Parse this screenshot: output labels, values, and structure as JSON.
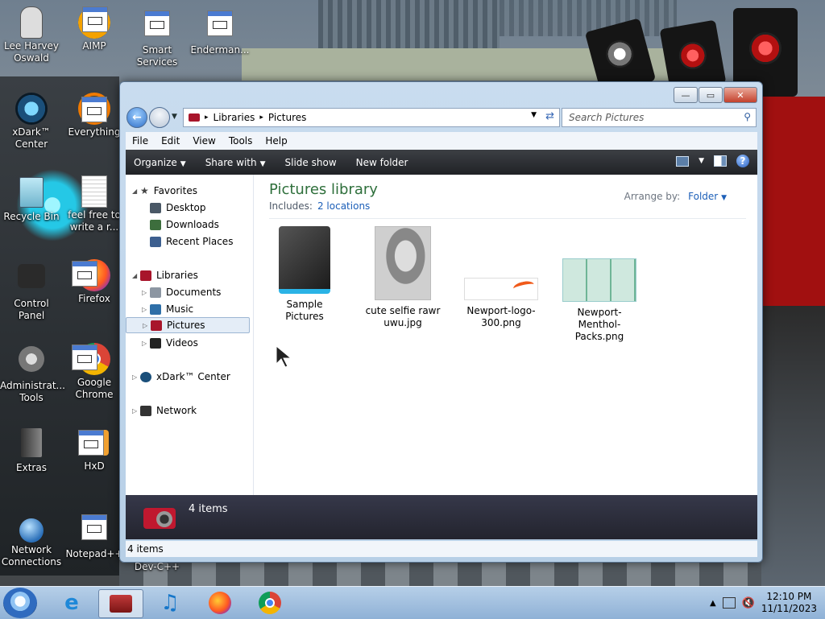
{
  "desktop": {
    "icons": [
      {
        "label": "Lee Harvey Oswald",
        "icon": "person-avatar-icon"
      },
      {
        "label": "AIMP",
        "icon": "aimp-app-icon"
      },
      {
        "label": "Smart Services",
        "icon": "smart-services-icon"
      },
      {
        "label": "Enderman...",
        "icon": "enderman-app-icon"
      },
      {
        "label": "xDark™ Center",
        "icon": "xdark-center-icon"
      },
      {
        "label": "Everything",
        "icon": "everything-app-icon"
      },
      {
        "label": "Recycle Bin",
        "icon": "recycle-bin-icon"
      },
      {
        "label": "feel free to write a r...",
        "icon": "text-document-icon"
      },
      {
        "label": "Control Panel",
        "icon": "control-panel-icon"
      },
      {
        "label": "Firefox",
        "icon": "firefox-icon"
      },
      {
        "label": "Administrat... Tools",
        "icon": "admin-tools-icon"
      },
      {
        "label": "Google Chrome",
        "icon": "chrome-icon"
      },
      {
        "label": "Extras",
        "icon": "extras-folder-icon"
      },
      {
        "label": "HxD",
        "icon": "hxd-app-icon"
      },
      {
        "label": "Network Connections",
        "icon": "network-connections-icon"
      },
      {
        "label": "Notepad++",
        "icon": "notepadpp-icon"
      },
      {
        "label": "Dev-C++",
        "icon": "devcpp-icon"
      }
    ]
  },
  "window": {
    "caption_buttons": {
      "minimize": "—",
      "maximize": "▭",
      "close": "✕"
    },
    "address": {
      "crumb1": "Libraries",
      "crumb2": "Pictures",
      "separator": "▸"
    },
    "search": {
      "placeholder": "Search Pictures"
    },
    "menu": [
      "File",
      "Edit",
      "View",
      "Tools",
      "Help"
    ],
    "toolbar": {
      "organize": "Organize",
      "share": "Share with",
      "slideshow": "Slide show",
      "newfolder": "New folder",
      "help": "?"
    },
    "nav": {
      "favorites": "Favorites",
      "desktop": "Desktop",
      "downloads": "Downloads",
      "recent": "Recent Places",
      "libraries": "Libraries",
      "documents": "Documents",
      "music": "Music",
      "pictures": "Pictures",
      "videos": "Videos",
      "xdark": "xDark™ Center",
      "network": "Network"
    },
    "library": {
      "title": "Pictures library",
      "includes_label": "Includes:",
      "locations_link": "2 locations",
      "arrange_label": "Arrange by:",
      "arrange_value": "Folder"
    },
    "files": [
      {
        "name": "Sample Pictures",
        "kind": "folder"
      },
      {
        "name": "cute selfie rawr uwu.jpg",
        "kind": "photo"
      },
      {
        "name": "Newport-logo-300.png",
        "kind": "logo"
      },
      {
        "name": "Newport-Menthol-Packs.png",
        "kind": "packs"
      }
    ],
    "details": {
      "count": "4 items"
    },
    "status": {
      "count": "4 items"
    }
  },
  "taskbar": {
    "clock_time": "12:10 PM",
    "clock_date": "11/11/2023"
  },
  "colors": {
    "library_title": "#2e6f3b",
    "link": "#1c5fb8",
    "toolbar_bg": "#2a2c31",
    "taskbar": "#a4c2e2"
  }
}
